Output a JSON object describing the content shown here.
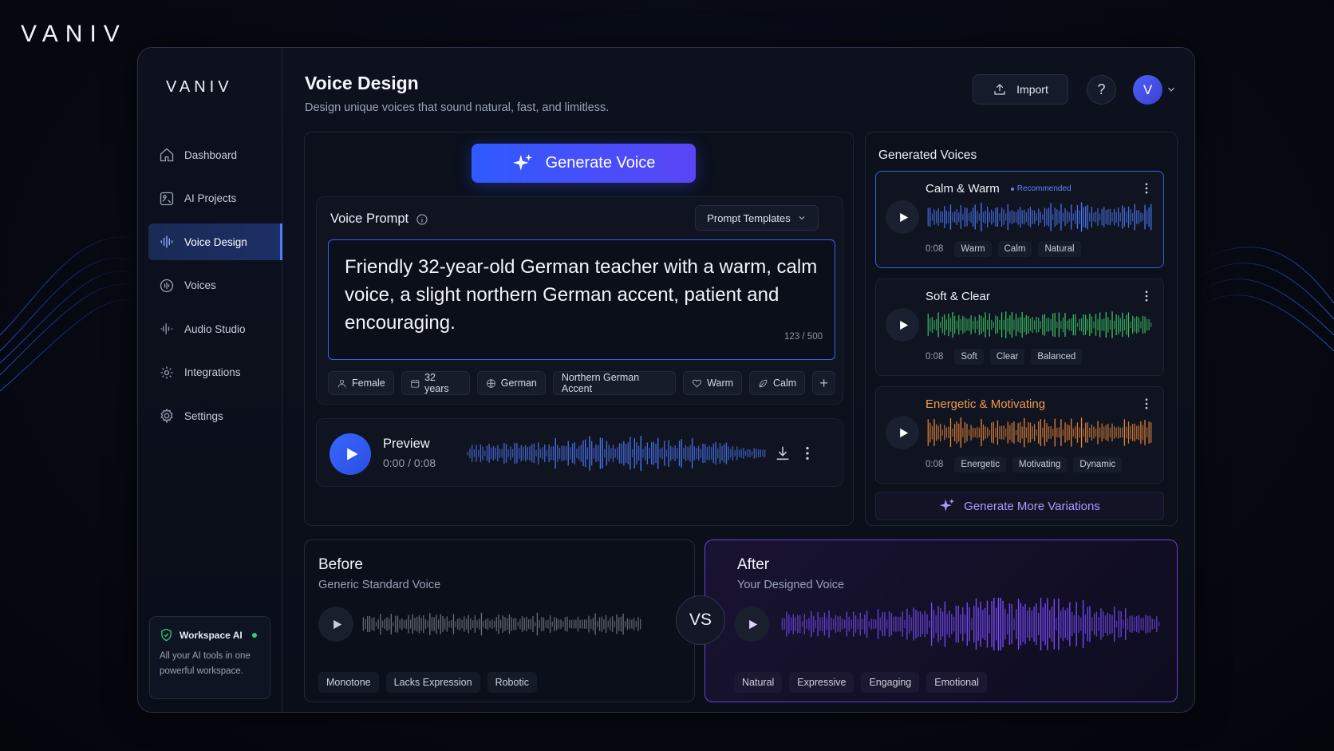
{
  "brand": "VANIV",
  "sidebar": {
    "logo": "VANIV",
    "items": [
      {
        "label": "Dashboard",
        "icon": "home-icon"
      },
      {
        "label": "AI Projects",
        "icon": "projects-icon"
      },
      {
        "label": "Voice Design",
        "icon": "waveform-icon",
        "active": true
      },
      {
        "label": "Voices",
        "icon": "voice-icon"
      },
      {
        "label": "Audio Studio",
        "icon": "audio-studio-icon"
      },
      {
        "label": "Integrations",
        "icon": "integrations-icon"
      },
      {
        "label": "Settings",
        "icon": "gear-icon"
      }
    ],
    "workspace": {
      "title": "Workspace AI",
      "description": "All your AI tools in one powerful workspace.",
      "status_color": "#35d07f"
    }
  },
  "header": {
    "title": "Voice Design",
    "subtitle": "Design unique voices that sound natural, fast, and limitless.",
    "import_label": "Import",
    "help_label": "?",
    "avatar_letter": "V"
  },
  "design": {
    "generate_label": "Generate Voice",
    "prompt_label": "Voice Prompt",
    "templates_label": "Prompt Templates",
    "prompt_text": "Friendly 32-year-old German teacher with a warm, calm voice, a slight northern German accent, patient and encouraging.",
    "char_count": "123 / 500",
    "chips": [
      {
        "label": "Female",
        "icon": "person-icon"
      },
      {
        "label": "32 years",
        "icon": "calendar-icon"
      },
      {
        "label": "German",
        "icon": "globe-icon"
      },
      {
        "label": "Northern German Accent",
        "icon": ""
      },
      {
        "label": "Warm",
        "icon": "heart-icon"
      },
      {
        "label": "Calm",
        "icon": "leaf-icon"
      }
    ],
    "add_chip_label": "+",
    "preview": {
      "title": "Preview",
      "time": "0:00 / 0:08"
    }
  },
  "generated": {
    "title": "Generated Voices",
    "voices": [
      {
        "name": "Calm & Warm",
        "badge": "Recommended",
        "duration": "0:08",
        "tags": [
          "Warm",
          "Calm",
          "Natural"
        ],
        "color": "#4f7cff",
        "name_color": "#f0f2f8"
      },
      {
        "name": "Soft & Clear",
        "badge": "",
        "duration": "0:08",
        "tags": [
          "Soft",
          "Clear",
          "Balanced"
        ],
        "color": "#3fd06a",
        "name_color": "#f0f2f8"
      },
      {
        "name": "Energetic & Motivating",
        "badge": "",
        "duration": "0:08",
        "tags": [
          "Energetic",
          "Motivating",
          "Dynamic"
        ],
        "color": "#f08a3a",
        "name_color": "#f29a4c"
      }
    ],
    "more_label": "Generate More Variations"
  },
  "compare": {
    "before": {
      "title": "Before",
      "subtitle": "Generic Standard Voice",
      "tags": [
        "Monotone",
        "Lacks Expression",
        "Robotic"
      ]
    },
    "vs_label": "VS",
    "after": {
      "title": "After",
      "subtitle": "Your Designed Voice",
      "tags": [
        "Natural",
        "Expressive",
        "Engaging",
        "Emotional"
      ]
    }
  },
  "colors": {
    "accent": "#3767ff",
    "purple": "#7b4dff"
  }
}
